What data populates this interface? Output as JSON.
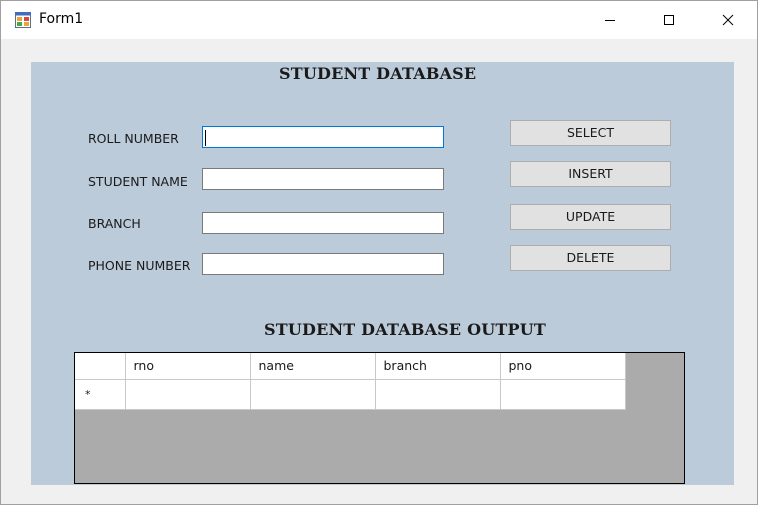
{
  "window": {
    "title": "Form1",
    "icon": "form-app-icon",
    "controls": [
      "minimize-icon",
      "maximize-icon",
      "close-icon"
    ]
  },
  "form": {
    "heading": "STUDENT DATABASE",
    "fields": [
      {
        "label": "ROLL NUMBER",
        "value": "",
        "focused": true
      },
      {
        "label": "STUDENT NAME",
        "value": ""
      },
      {
        "label": "BRANCH",
        "value": ""
      },
      {
        "label": "PHONE NUMBER",
        "value": ""
      }
    ],
    "buttons": [
      "SELECT",
      "INSERT",
      "UPDATE",
      "DELETE"
    ]
  },
  "output": {
    "heading": "STUDENT DATABASE OUTPUT",
    "columns": [
      "rno",
      "name",
      "branch",
      "pno"
    ],
    "new_row_marker": "*",
    "rows": []
  },
  "colors": {
    "form_background": "#bccbda",
    "grid_background": "#ababab",
    "focus_border": "#0078d7",
    "button_face": "#e1e1e1"
  }
}
